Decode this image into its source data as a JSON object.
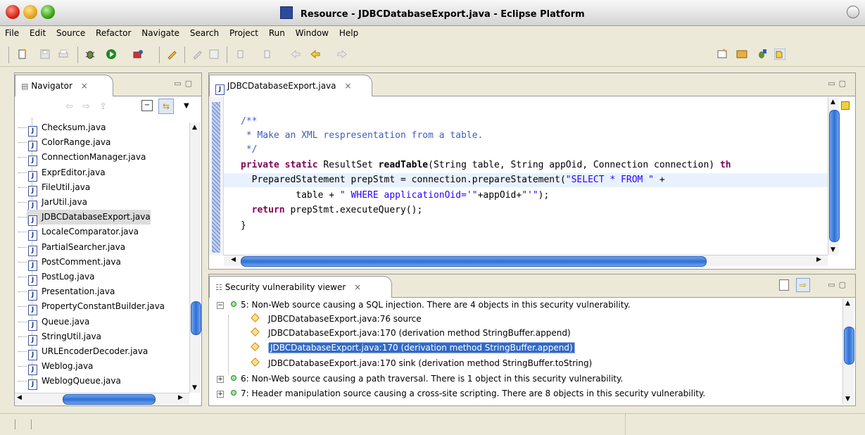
{
  "window": {
    "title": "Resource - JDBCDatabaseExport.java - Eclipse Platform"
  },
  "menu": [
    "File",
    "Edit",
    "Source",
    "Refactor",
    "Navigate",
    "Search",
    "Project",
    "Run",
    "Window",
    "Help"
  ],
  "navigator": {
    "tab_label": "Navigator",
    "close_glyph": "×",
    "files": [
      "Checksum.java",
      "ColorRange.java",
      "ConnectionManager.java",
      "ExprEditor.java",
      "FileUtil.java",
      "JarUtil.java",
      "JDBCDatabaseExport.java",
      "LocaleComparator.java",
      "PartialSearcher.java",
      "PostComment.java",
      "PostLog.java",
      "Presentation.java",
      "PropertyConstantBuilder.java",
      "Queue.java",
      "StringUtil.java",
      "URLEncoderDecoder.java",
      "Weblog.java",
      "WeblogQueue.java"
    ],
    "selected_file": "JDBCDatabaseExport.java"
  },
  "editor": {
    "tab_label": "JDBCDatabaseExport.java",
    "close_glyph": "×",
    "code": {
      "l1": "/**",
      "l2": " * Make an XML respresentation from a table.",
      "l3": " */",
      "l4_kw": "private static",
      "l4_a": " ResultSet ",
      "l4_method": "readTable",
      "l4_b": "(String table, String appOid, Connection connection) ",
      "l4_kw2": "th",
      "l5_a": "  PreparedStatement prepStmt = connection.prepareStatement(",
      "l5_str": "\"SELECT * FROM \"",
      "l5_b": " +",
      "l6_a": "          table + ",
      "l6_str1": "\" WHERE applicationOid='\"",
      "l6_b": "+appOid+",
      "l6_str2": "\"'\"",
      "l6_c": ");",
      "l7_kw": "  return",
      "l7_a": " prepStmt.executeQuery();",
      "l8": "}"
    }
  },
  "vuln_viewer": {
    "tab_label": "Security vulnerability viewer",
    "close_glyph": "×",
    "items": [
      {
        "text": "5: Non-Web source causing a SQL injection. There are  4  objects in this security vulnerability.",
        "expanded": true
      },
      {
        "text": "JDBCDatabaseExport.java:76 source",
        "child": true
      },
      {
        "text": "JDBCDatabaseExport.java:170 (derivation method StringBuffer.append)",
        "child": true
      },
      {
        "text": "JDBCDatabaseExport.java:170 (derivation method StringBuffer.append)",
        "child": true,
        "selected": true
      },
      {
        "text": "JDBCDatabaseExport.java:170 sink (derivation method StringBuffer.toString)",
        "child": true
      },
      {
        "text": "6: Non-Web source causing a path traversal. There is 1 object in this security vulnerability.",
        "expanded": false
      },
      {
        "text": "7: Header manipulation source causing a cross-site scripting. There are  8  objects in this security vulnerability.",
        "expanded": false
      }
    ]
  },
  "colors": {
    "selection": "#3169c6",
    "keyword": "#7f0055",
    "string": "#2a00ff",
    "comment": "#3f5fbf"
  }
}
